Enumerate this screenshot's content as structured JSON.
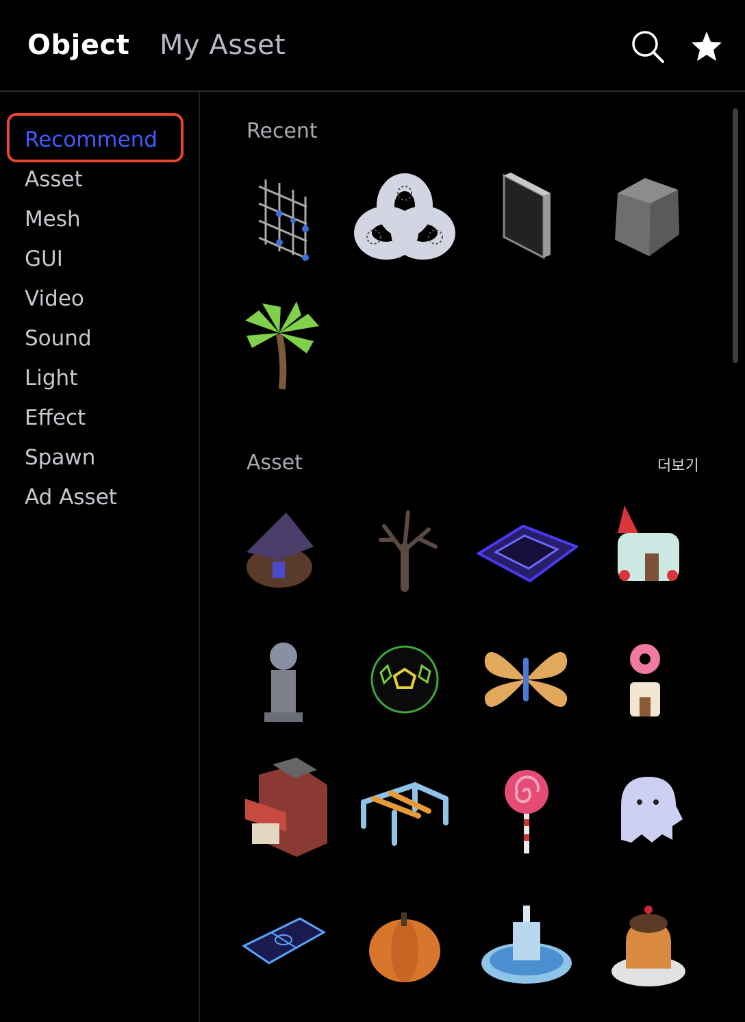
{
  "header": {
    "tab_object": "Object",
    "tab_my_asset": "My Asset",
    "search_icon": "search-icon",
    "favorite_icon": "star-icon"
  },
  "sidebar": {
    "items": [
      {
        "label": "Recommend",
        "selected": true
      },
      {
        "label": "Asset"
      },
      {
        "label": "Mesh"
      },
      {
        "label": "GUI"
      },
      {
        "label": "Video"
      },
      {
        "label": "Sound"
      },
      {
        "label": "Light"
      },
      {
        "label": "Effect"
      },
      {
        "label": "Spawn"
      },
      {
        "label": "Ad Asset"
      }
    ]
  },
  "sections": {
    "recent": {
      "title": "Recent",
      "items": [
        "grid-frame",
        "trefoil-knot",
        "black-panel",
        "gray-rock",
        "palm-tree"
      ]
    },
    "asset": {
      "title": "Asset",
      "more_label": "더보기",
      "items": [
        "witch-house",
        "dead-tree",
        "neon-arena",
        "candy-house",
        "globe-pedestal",
        "neon-soccer-ball",
        "butterfly-propeller",
        "donut-tower",
        "brick-shop",
        "playground-bars",
        "lollipop",
        "ghost",
        "neon-soccer-field",
        "pumpkin",
        "fountain",
        "cat-pudding"
      ]
    }
  },
  "colors": {
    "background": "#000000",
    "selected": "#3d5cff",
    "highlight_border": "#e8472f",
    "inactive_text": "#b8b8c8"
  }
}
